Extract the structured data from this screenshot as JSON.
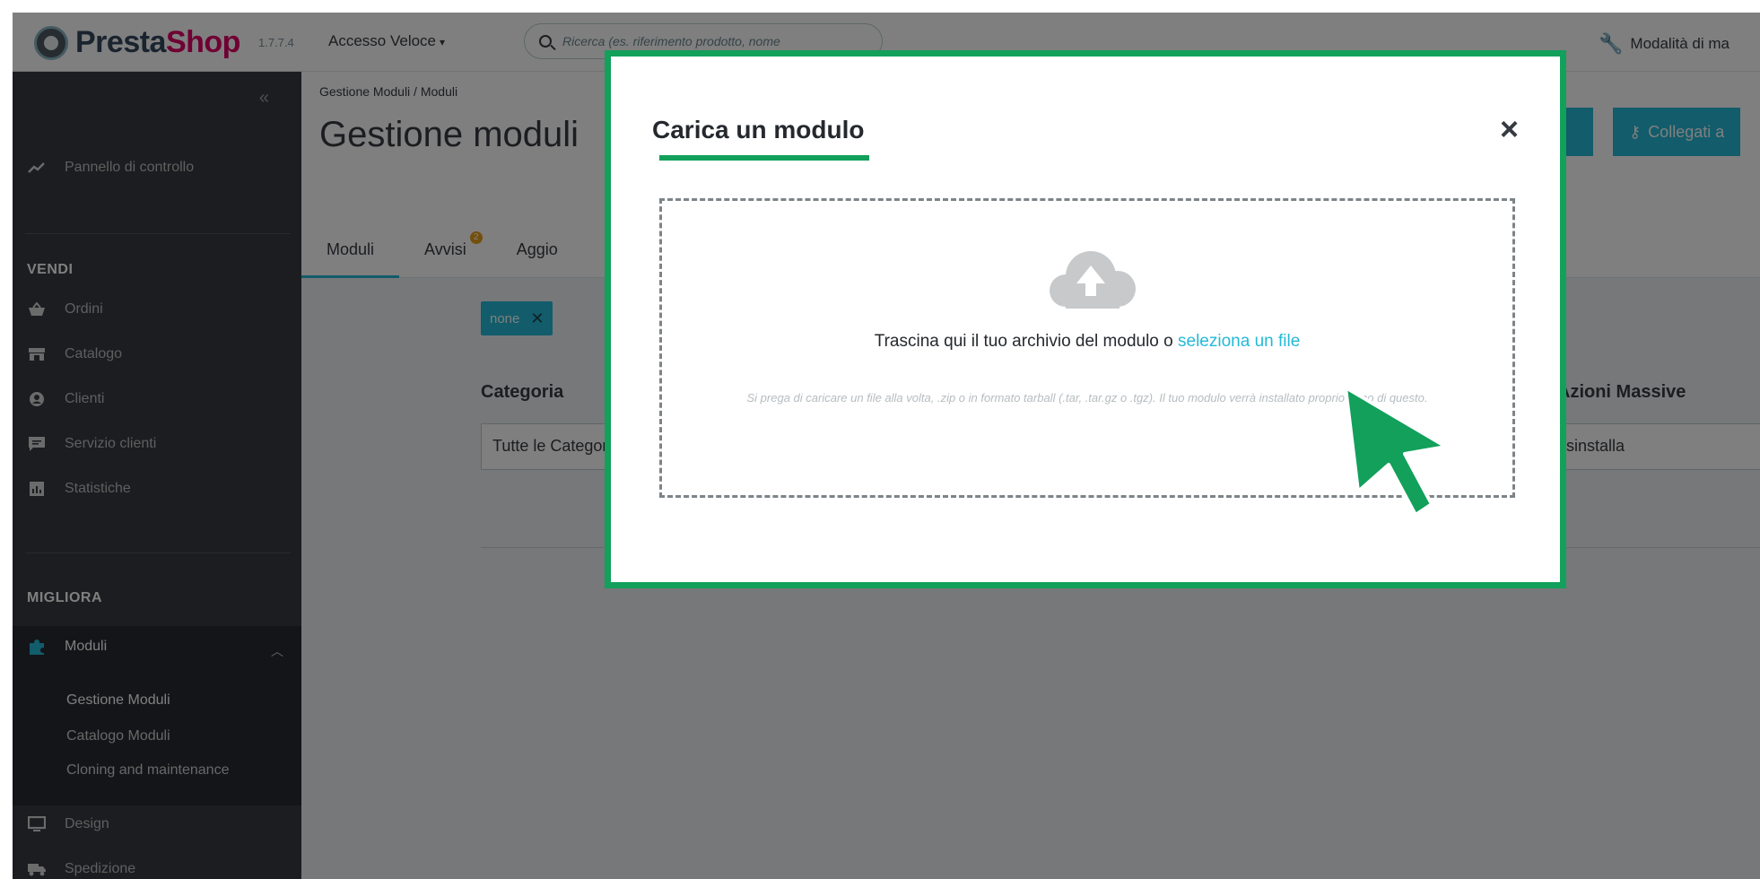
{
  "brand": {
    "name_part1": "Presta",
    "name_part2": "Shop",
    "version": "1.7.7.4"
  },
  "topbar": {
    "quick_access": "Accesso Veloce",
    "search_placeholder": "Ricerca (es. riferimento prodotto, nome",
    "maintenance": "Modalità di ma"
  },
  "sidebar": {
    "collapse": "«",
    "dashboard": "Pannello di controllo",
    "section_sell": "VENDI",
    "sell_items": [
      {
        "label": "Ordini",
        "icon": "basket-icon"
      },
      {
        "label": "Catalogo",
        "icon": "store-icon"
      },
      {
        "label": "Clienti",
        "icon": "user-icon"
      },
      {
        "label": "Servizio clienti",
        "icon": "chat-icon"
      },
      {
        "label": "Statistiche",
        "icon": "chart-icon"
      }
    ],
    "section_improve": "MIGLIORA",
    "modules": "Moduli",
    "modules_sub": [
      "Gestione Moduli",
      "Catalogo Moduli",
      "Cloning and maintenance"
    ],
    "design": "Design",
    "shipping": "Spedizione"
  },
  "main": {
    "breadcrumb": "Gestione Moduli  /  Moduli",
    "title": "Gestione moduli",
    "tabs": [
      "Moduli",
      "Avvisi",
      "Aggio"
    ],
    "notice_badge": "2",
    "connect_button": "Collegati a",
    "filter_chip": "none",
    "category_label": "Categoria",
    "category_value": "Tutte le Categorie",
    "bulk_label": "Azioni Massive",
    "bulk_value": "Disinstalla"
  },
  "modal": {
    "title": "Carica un modulo",
    "close": "×",
    "drop_text": "Trascina qui il tuo archivio del modulo o ",
    "drop_link": "seleziona un file",
    "hint": "Si prega di caricare un file alla volta, .zip o in formato tarball (.tar, .tar.gz o .tgz). Il tuo modulo verrà installato proprio dopo di questo."
  },
  "colors": {
    "accent": "#25b9d7",
    "highlight": "#12a05b",
    "sidebar": "#363a41"
  }
}
